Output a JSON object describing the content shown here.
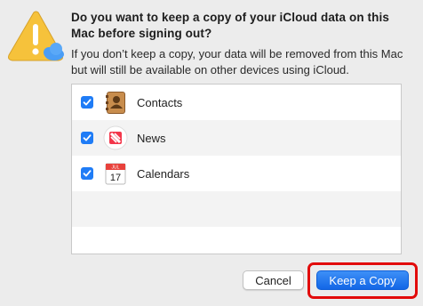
{
  "dialog": {
    "title": "Do you want to keep a copy of your iCloud data on this Mac before signing out?",
    "message": "If you don’t keep a copy, your data will be removed from this Mac but will still be available on other devices using iCloud.",
    "icon": "warning-with-icloud-icon",
    "accent_color": "#1f7cf6",
    "highlight_color": "#e20b0b"
  },
  "items": [
    {
      "label": "Contacts",
      "checked": true,
      "icon": "contacts-icon"
    },
    {
      "label": "News",
      "checked": true,
      "icon": "news-icon"
    },
    {
      "label": "Calendars",
      "checked": true,
      "icon": "calendar-icon",
      "icon_month": "JUL",
      "icon_day": "17"
    }
  ],
  "buttons": {
    "cancel_label": "Cancel",
    "keep_label": "Keep a Copy"
  }
}
